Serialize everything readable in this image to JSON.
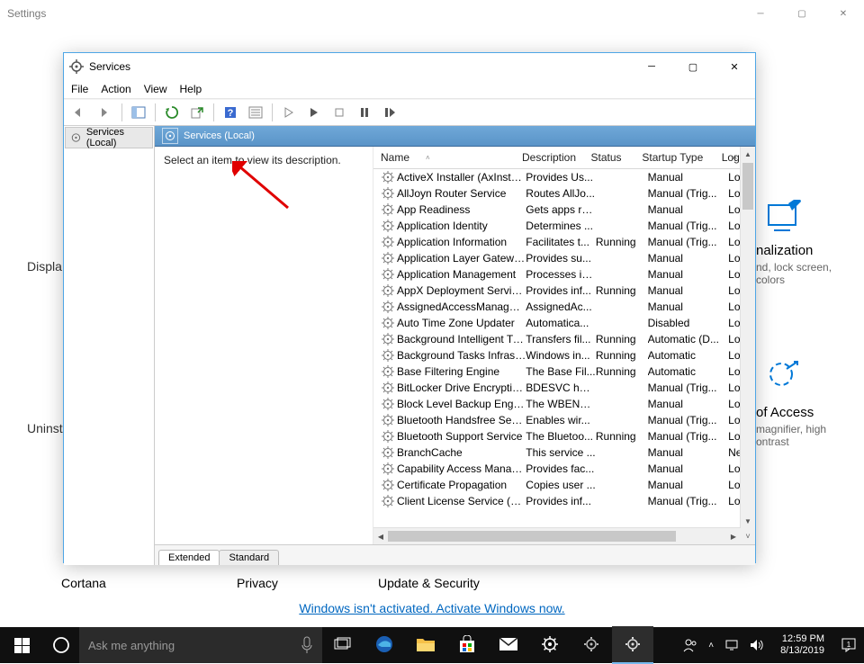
{
  "settings": {
    "title": "Settings",
    "left_labels": {
      "display": "Displa",
      "cortana": "Cortana",
      "uninstall": "Uninstall,",
      "privacy": "Privacy",
      "update": "Update & Security"
    },
    "personalization": {
      "title": "nalization",
      "sub": "nd, lock screen,\ncolors"
    },
    "ease_of_access": {
      "title": "of Access",
      "sub": "magnifier, high\nontrast"
    },
    "activate_link": "Windows isn't activated. Activate Windows now."
  },
  "services": {
    "title": "Services",
    "menu": [
      "File",
      "Action",
      "View",
      "Help"
    ],
    "tree_item": "Services (Local)",
    "header_band": "Services (Local)",
    "desc_hint": "Select an item to view its description.",
    "cols": {
      "name": "Name",
      "desc": "Description",
      "status": "Status",
      "startup": "Startup Type",
      "log": "Log"
    },
    "tabs": {
      "extended": "Extended",
      "standard": "Standard"
    },
    "rows": [
      {
        "name": "ActiveX Installer (AxInstSV)",
        "desc": "Provides Us...",
        "status": "",
        "startup": "Manual",
        "log": "Loc"
      },
      {
        "name": "AllJoyn Router Service",
        "desc": "Routes AllJo...",
        "status": "",
        "startup": "Manual (Trig...",
        "log": "Loc"
      },
      {
        "name": "App Readiness",
        "desc": "Gets apps re...",
        "status": "",
        "startup": "Manual",
        "log": "Loc"
      },
      {
        "name": "Application Identity",
        "desc": "Determines ...",
        "status": "",
        "startup": "Manual (Trig...",
        "log": "Loc"
      },
      {
        "name": "Application Information",
        "desc": "Facilitates t...",
        "status": "Running",
        "startup": "Manual (Trig...",
        "log": "Loc"
      },
      {
        "name": "Application Layer Gateway ...",
        "desc": "Provides su...",
        "status": "",
        "startup": "Manual",
        "log": "Loc"
      },
      {
        "name": "Application Management",
        "desc": "Processes in...",
        "status": "",
        "startup": "Manual",
        "log": "Loc"
      },
      {
        "name": "AppX Deployment Service (...",
        "desc": "Provides inf...",
        "status": "Running",
        "startup": "Manual",
        "log": "Loc"
      },
      {
        "name": "AssignedAccessManager Se...",
        "desc": "AssignedAc...",
        "status": "",
        "startup": "Manual",
        "log": "Loc"
      },
      {
        "name": "Auto Time Zone Updater",
        "desc": "Automatica...",
        "status": "",
        "startup": "Disabled",
        "log": "Loc"
      },
      {
        "name": "Background Intelligent Tran...",
        "desc": "Transfers fil...",
        "status": "Running",
        "startup": "Automatic (D...",
        "log": "Loc"
      },
      {
        "name": "Background Tasks Infrastru...",
        "desc": "Windows in...",
        "status": "Running",
        "startup": "Automatic",
        "log": "Loc"
      },
      {
        "name": "Base Filtering Engine",
        "desc": "The Base Fil...",
        "status": "Running",
        "startup": "Automatic",
        "log": "Loc"
      },
      {
        "name": "BitLocker Drive Encryption ...",
        "desc": "BDESVC hos...",
        "status": "",
        "startup": "Manual (Trig...",
        "log": "Loc"
      },
      {
        "name": "Block Level Backup Engine ...",
        "desc": "The WBENG...",
        "status": "",
        "startup": "Manual",
        "log": "Loc"
      },
      {
        "name": "Bluetooth Handsfree Service",
        "desc": "Enables wir...",
        "status": "",
        "startup": "Manual (Trig...",
        "log": "Loc"
      },
      {
        "name": "Bluetooth Support Service",
        "desc": "The Bluetoo...",
        "status": "Running",
        "startup": "Manual (Trig...",
        "log": "Loc"
      },
      {
        "name": "BranchCache",
        "desc": "This service ...",
        "status": "",
        "startup": "Manual",
        "log": "Net"
      },
      {
        "name": "Capability Access Manager ...",
        "desc": "Provides fac...",
        "status": "",
        "startup": "Manual",
        "log": "Loc"
      },
      {
        "name": "Certificate Propagation",
        "desc": "Copies user ...",
        "status": "",
        "startup": "Manual",
        "log": "Loc"
      },
      {
        "name": "Client License Service (ClipS...",
        "desc": "Provides inf...",
        "status": "",
        "startup": "Manual (Trig...",
        "log": "Loc"
      }
    ]
  },
  "taskbar": {
    "search_placeholder": "Ask me anything",
    "clock": {
      "time": "12:59 PM",
      "date": "8/13/2019"
    }
  }
}
